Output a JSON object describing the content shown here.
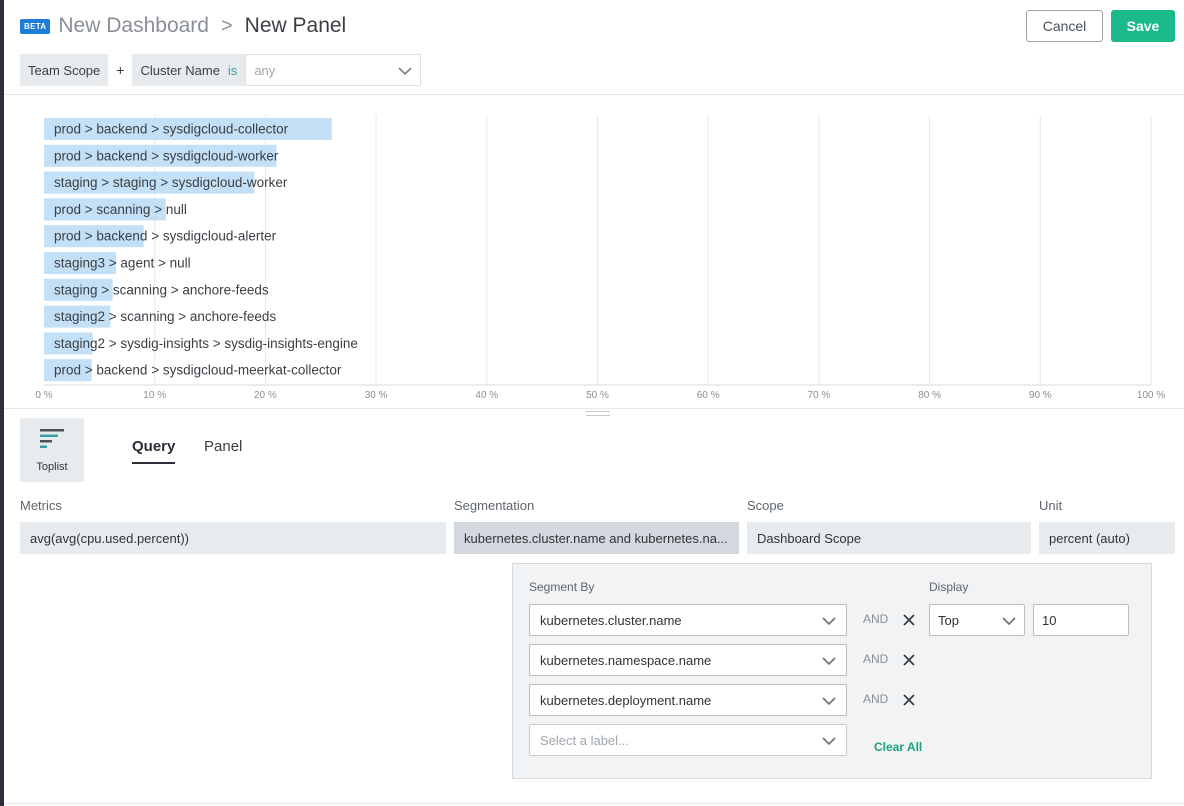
{
  "header": {
    "badge": "BETA",
    "parent": "New Dashboard",
    "separator": ">",
    "title": "New Panel",
    "cancel_label": "Cancel",
    "save_label": "Save"
  },
  "scope": {
    "team_scope": "Team Scope",
    "plus": "+",
    "filter_label": "Cluster Name",
    "operator": "is",
    "value_placeholder": "any"
  },
  "chart_data": {
    "type": "bar",
    "orientation": "horizontal",
    "categories": [
      "prod > backend > sysdigcloud-collector",
      "prod > backend > sysdigcloud-worker",
      "staging > staging > sysdigcloud-worker",
      "prod > scanning > null",
      "prod > backend > sysdigcloud-alerter",
      "staging3 > agent > null",
      "staging > scanning > anchore-feeds",
      "staging2 > scanning > anchore-feeds",
      "staging2 > sysdig-insights > sysdig-insights-engine",
      "prod > backend > sysdigcloud-meerkat-collector"
    ],
    "values": [
      26,
      21,
      19,
      11,
      9,
      6.5,
      6.2,
      6.0,
      4.4,
      4.3
    ],
    "xlim": [
      0,
      100
    ],
    "x_ticks": [
      "0 %",
      "10 %",
      "20 %",
      "30 %",
      "40 %",
      "50 %",
      "60 %",
      "70 %",
      "80 %",
      "90 %",
      "100 %"
    ],
    "grid": true,
    "bar_color": "#c3e0f7"
  },
  "editor": {
    "viz_label": "Toplist",
    "tabs": [
      "Query",
      "Panel"
    ],
    "columns": {
      "metrics_label": "Metrics",
      "metrics_value": "avg(avg(cpu.used.percent))",
      "segmentation_label": "Segmentation",
      "segmentation_value": "kubernetes.cluster.name and kubernetes.na...",
      "scope_label": "Scope",
      "scope_value": "Dashboard Scope",
      "unit_label": "Unit",
      "unit_value": "percent (auto)"
    }
  },
  "segment": {
    "segment_by_label": "Segment By",
    "display_label": "Display",
    "rows": [
      {
        "value": "kubernetes.cluster.name",
        "and": "AND"
      },
      {
        "value": "kubernetes.namespace.name",
        "and": "AND"
      },
      {
        "value": "kubernetes.deployment.name",
        "and": "AND"
      }
    ],
    "add_placeholder": "Select a label...",
    "clear_all": "Clear All",
    "display_mode": "Top",
    "display_count": "10"
  }
}
